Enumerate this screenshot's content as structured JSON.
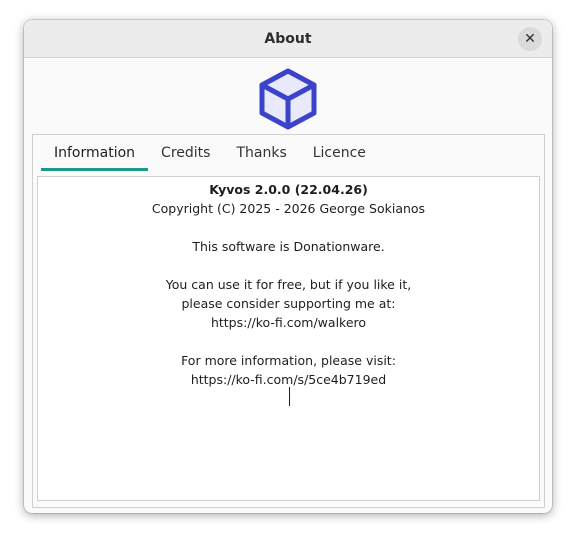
{
  "window": {
    "title": "About"
  },
  "tabs": [
    {
      "label": "Information",
      "active": true
    },
    {
      "label": "Credits",
      "active": false
    },
    {
      "label": "Thanks",
      "active": false
    },
    {
      "label": "Licence",
      "active": false
    }
  ],
  "info": {
    "app_name": "Kyvos 2.0.0 (22.04.26)",
    "copyright": "Copyright (C) 2025 - 2026 George Sokianos",
    "donation": "This software is Donationware.",
    "support_line1": "You can use it for free, but if you like it,",
    "support_line2": "please consider supporting me at:",
    "support_url": "https://ko-fi.com/walkero",
    "more_info": "For more information, please visit:",
    "more_url": "https://ko-fi.com/s/5ce4b719ed"
  },
  "icons": {
    "close": "close-icon",
    "logo": "cube-logo-icon"
  },
  "colors": {
    "accent": "#1a9a8a",
    "logo": "#3a43c9",
    "logo_fill": "#e8e9fb"
  }
}
